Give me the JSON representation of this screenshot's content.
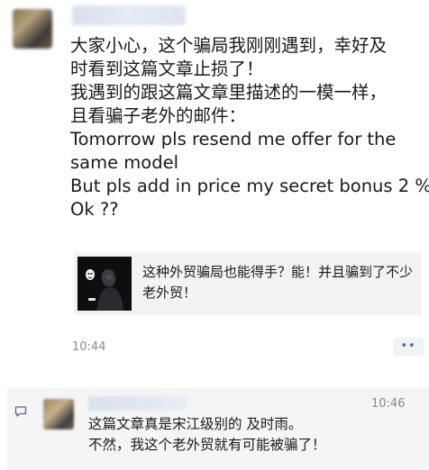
{
  "post": {
    "text_lines": [
      "大家小心，这个骗局我刚刚遇到，幸好及",
      "时看到这篇文章止损了！",
      "我遇到的跟这篇文章里描述的一模一样，",
      "且看骗子老外的邮件：",
      "Tomorrow pls resend me offer for the",
      "same model",
      "But pls add in price my secret bonus 2 %",
      "Ok ??"
    ],
    "link": {
      "title": "这种外贸骗局也能得手？能！并且骗到了不少老外贸！",
      "thumbnail": "masked-figure-image"
    },
    "time": "10:44",
    "more_icon": "more-dots-icon"
  },
  "comment": {
    "icon": "comment-bubble-icon",
    "time": "10:46",
    "text_lines": [
      "这篇文章真是宋江级别的 及时雨。",
      "不然，我这个老外贸就有可能被骗了！"
    ]
  },
  "colors": {
    "link_blue": "#576b95",
    "secondary_text": "#8a8a8a",
    "comment_bg": "#f5f5f5",
    "card_bg": "#f3f3f3"
  }
}
